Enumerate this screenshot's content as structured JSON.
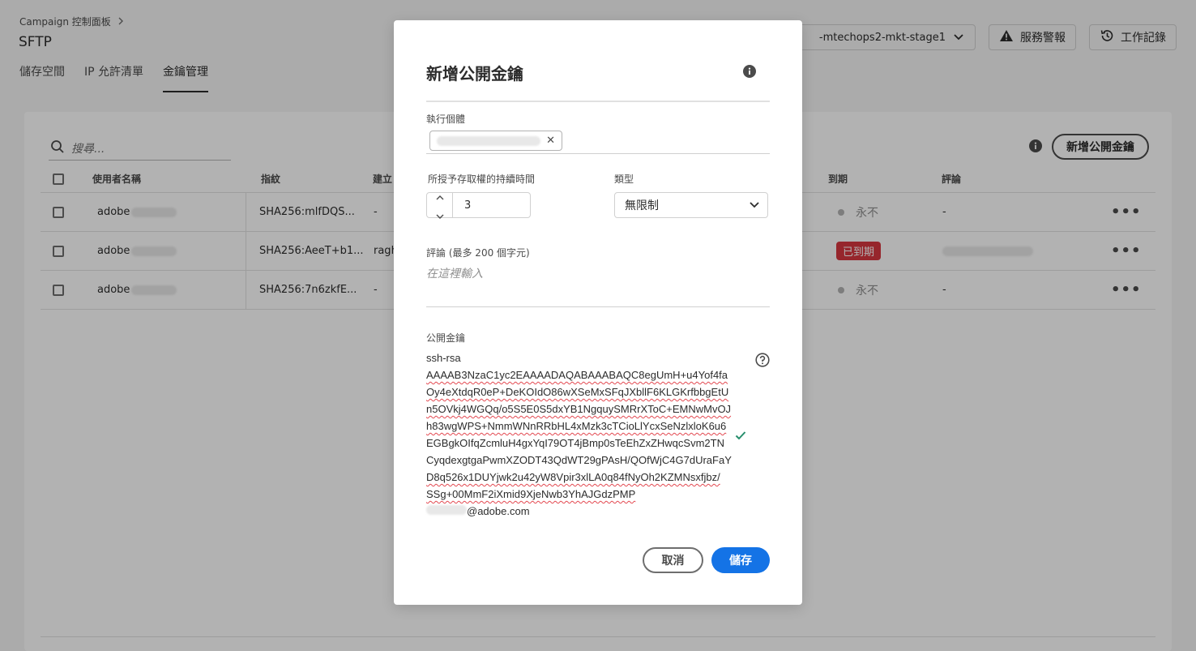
{
  "header": {
    "breadcrumb": "Campaign 控制面板",
    "page_title": "SFTP",
    "tabs": [
      {
        "label": "儲存空間"
      },
      {
        "label": "IP 允許清單"
      },
      {
        "label": "金鑰管理"
      }
    ],
    "env_select_value": "-mtechops2-mkt-stage1",
    "service_alerts_label": "服務警報",
    "activity_log_label": "工作記錄"
  },
  "panel": {
    "search_placeholder": "搜尋...",
    "add_key_label": "新增公開金鑰",
    "columns": {
      "username": "使用者名稱",
      "fingerprint": "指紋",
      "created": "建立",
      "expires": "到期",
      "comment": "評論"
    },
    "rows": [
      {
        "username": "adobe",
        "fingerprint": "SHA256:mlfDQS...",
        "created": "-",
        "expires": "永不",
        "comment": "-"
      },
      {
        "username": "adobe",
        "fingerprint": "SHA256:AeeT+b1...",
        "created": "ragh",
        "expires": "已到期",
        "comment": ""
      },
      {
        "username": "adobe",
        "fingerprint": "SHA256:7n6zkfE...",
        "created": "-",
        "expires": "永不",
        "comment": "-"
      }
    ]
  },
  "dialog": {
    "title": "新增公開金鑰",
    "instance_label": "執行個體",
    "duration_label": "所授予存取權的持續時間",
    "duration_value": "3",
    "type_label": "類型",
    "type_value": "無限制",
    "comment_label": "評論 (最多 200 個字元)",
    "comment_placeholder": "在這裡輸入",
    "public_key_label": "公開金鑰",
    "public_key_lines": [
      "ssh-rsa",
      "AAAAB3NzaC1yc2EAAAADAQABAAABAQC8egUmH+u4Yof4fa",
      "Oy4eXtdqR0eP+DeKOIdO86wXSeMxSFqJXbllF6KLGKrfbbgEtU",
      "n5OVkj4WGQq/o5S5E0S5dxYB1NgquySMRrXToC+EMNwMvOJ",
      "h83wgWPS+NmmWNnRRbHL4xMzk3cTCioLlYcxSeNzlxloK6u6",
      "EGBgkOIfqZcmluH4gxYqI79OT4jBmp0sTeEhZxZHwqcSvm2TN",
      "CyqdexgtgaPwmXZODT43QdWT29gPAsH/QOfWjC4G7dUraFaY",
      "D8q526x1DUYjwk2u42yW8Vpir3xlLA0q84fNyOh2KZMNsxfjbz/",
      "SSg+00MmF2iXmid9XjeNwb3YhAJGdzPMP"
    ],
    "public_key_email": "@adobe.com",
    "cancel_label": "取消",
    "save_label": "儲存"
  },
  "colors": {
    "primary": "#1473e6",
    "negative": "#d7373f",
    "valid": "#268e6c"
  },
  "icons": [
    "chevron-right-icon",
    "chevron-down-icon",
    "alert-icon",
    "history-icon",
    "search-icon",
    "info-icon",
    "more-icon",
    "clear-icon",
    "stepper-up-icon",
    "stepper-down-icon",
    "help-icon",
    "checkmark-icon"
  ]
}
